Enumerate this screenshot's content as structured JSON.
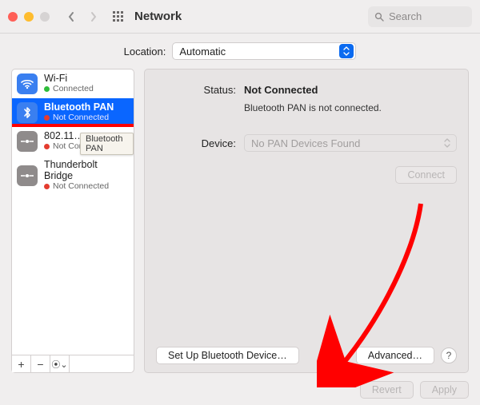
{
  "window": {
    "title": "Network"
  },
  "search": {
    "placeholder": "Search"
  },
  "location": {
    "label": "Location:",
    "value": "Automatic"
  },
  "sidebar": {
    "items": [
      {
        "name": "Wi-Fi",
        "status": "Connected",
        "dot": "green",
        "icon_bg": "#3a7ff0"
      },
      {
        "name": "Bluetooth PAN",
        "status": "Not Connected",
        "dot": "red",
        "icon_bg": "#3a7ff0",
        "selected": true
      },
      {
        "name": "802.11…",
        "status": "Not Connected",
        "dot": "red",
        "icon_bg": "#8f8b8b"
      },
      {
        "name": "Thunderbolt Bridge",
        "status": "Not Connected",
        "dot": "red",
        "icon_bg": "#8f8b8b"
      }
    ],
    "tooltip": "Bluetooth PAN"
  },
  "detail": {
    "status_label": "Status:",
    "status_value": "Not Connected",
    "status_sub": "Bluetooth PAN is not connected.",
    "device_label": "Device:",
    "device_value": "No PAN Devices Found",
    "connect_label": "Connect",
    "setup_label": "Set Up Bluetooth Device…",
    "advanced_label": "Advanced…",
    "help_label": "?"
  },
  "footer": {
    "revert_label": "Revert",
    "apply_label": "Apply"
  }
}
